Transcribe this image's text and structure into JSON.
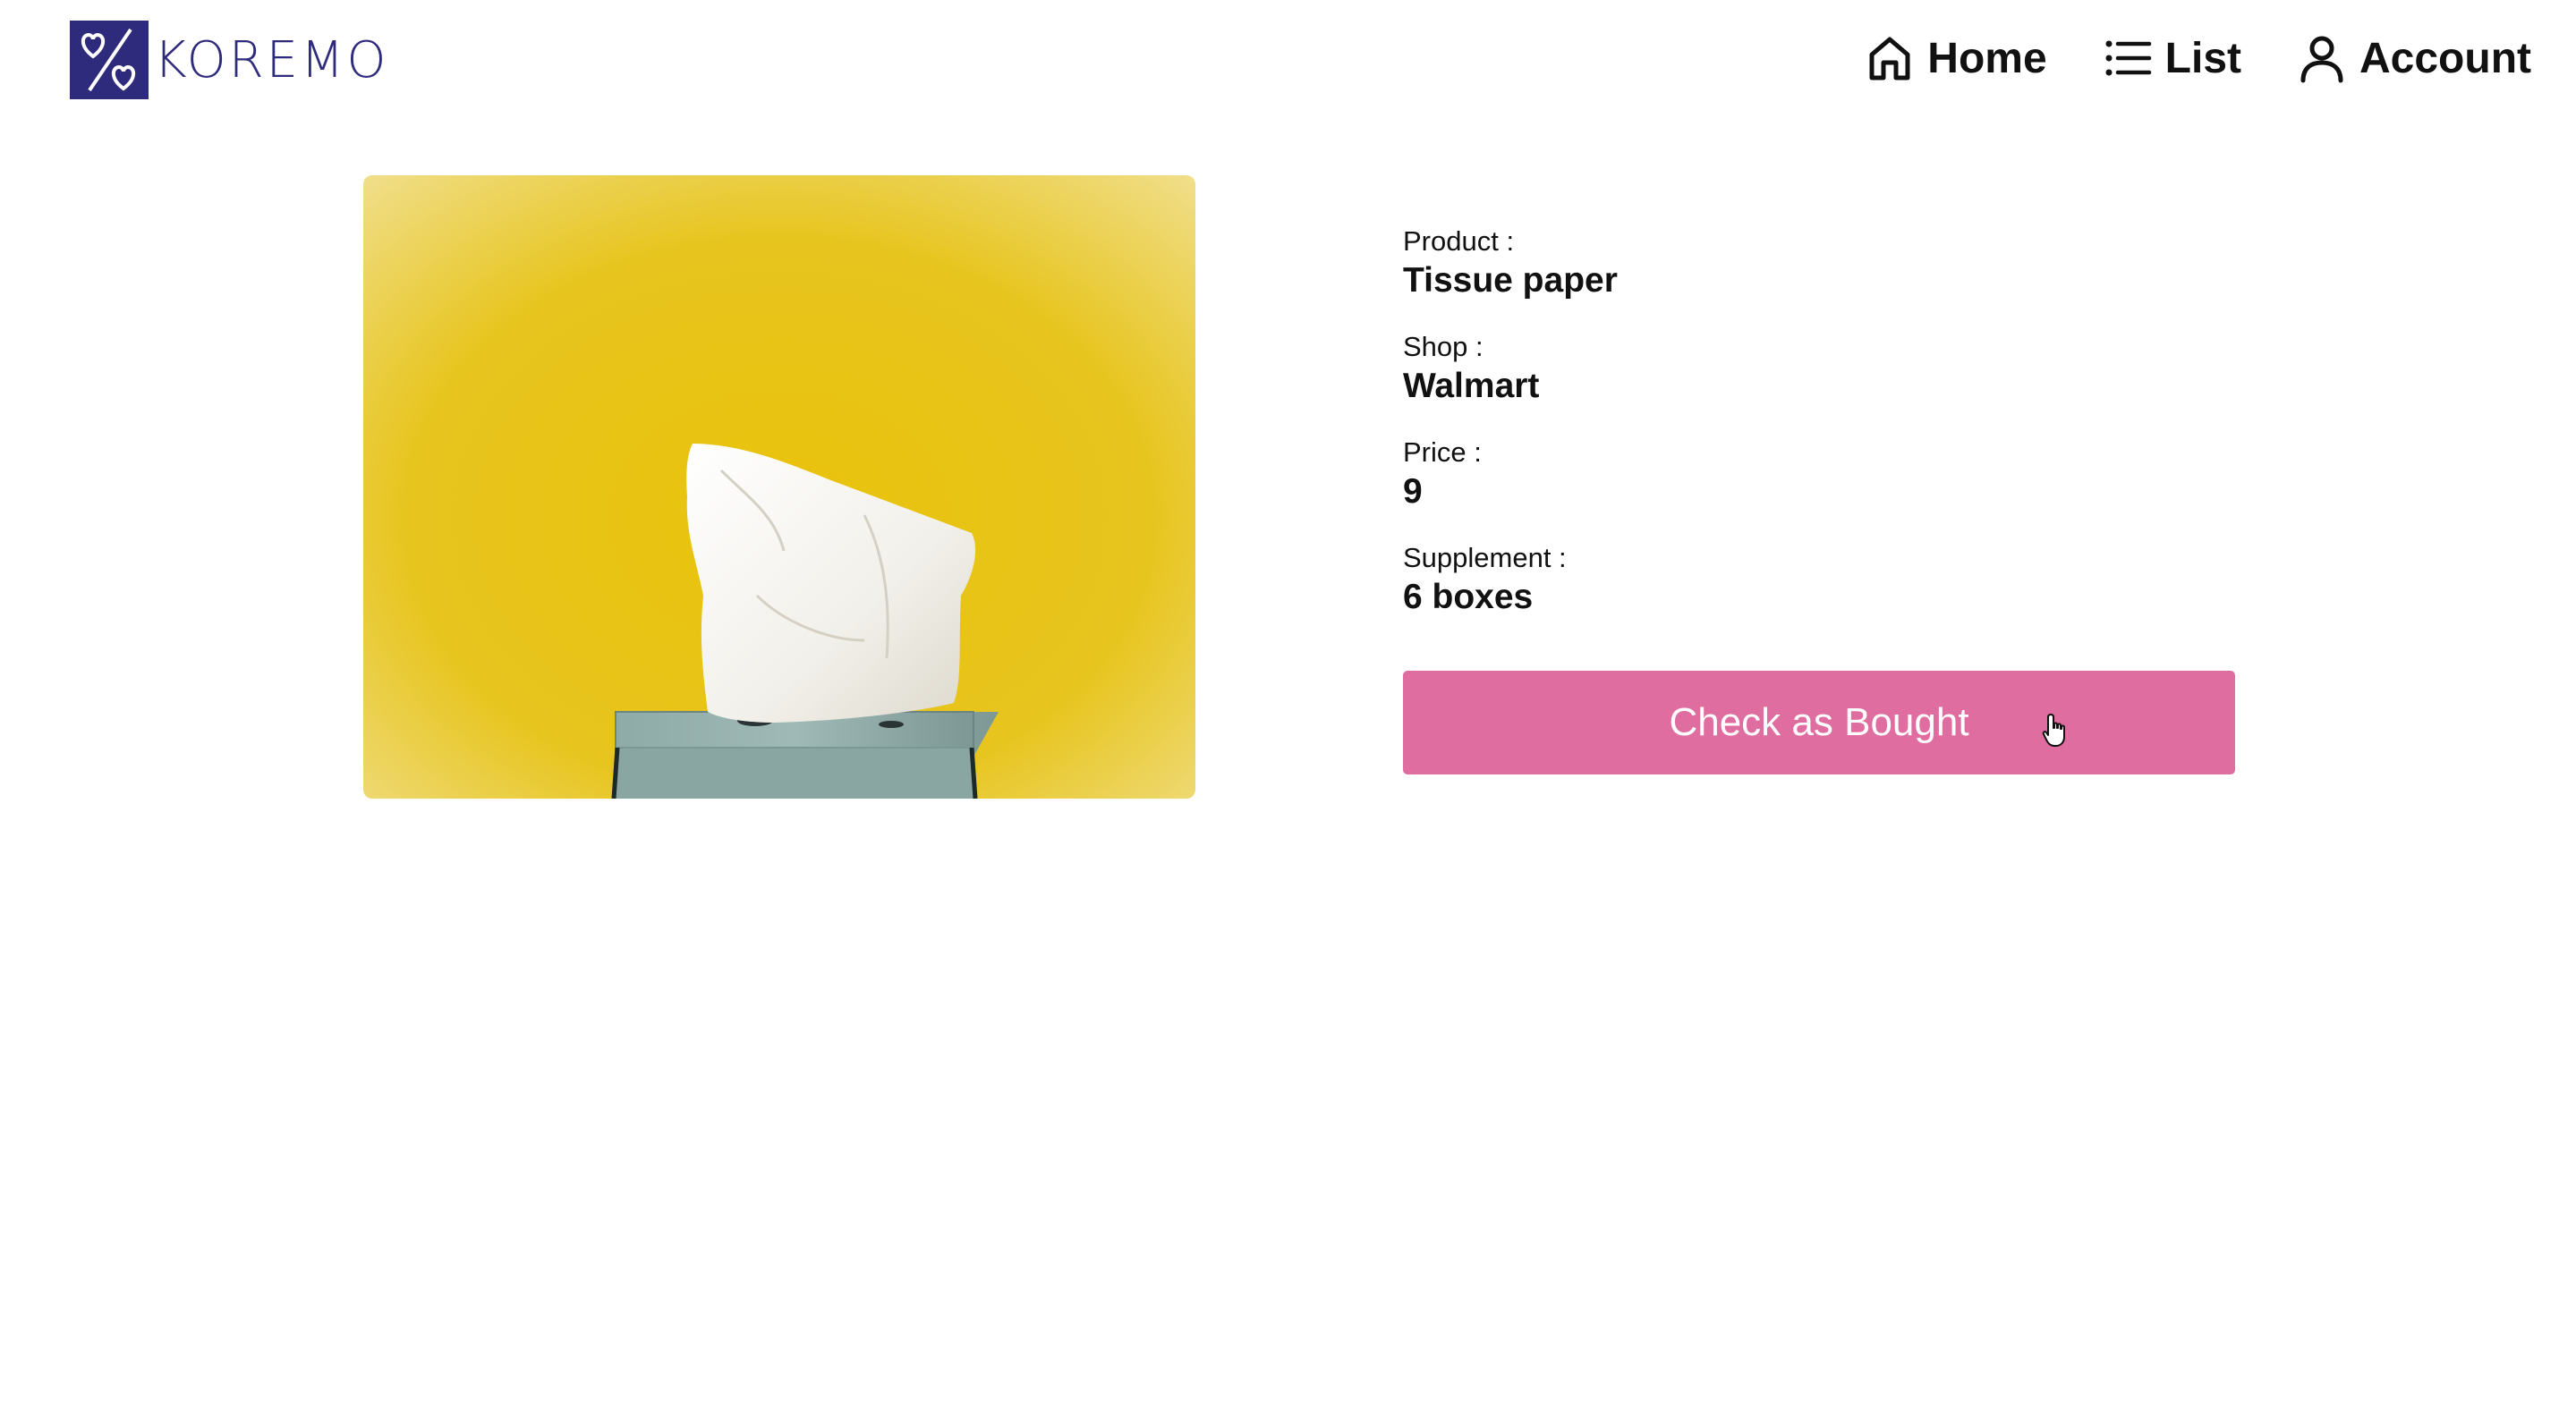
{
  "header": {
    "logo_text": "KOREMO",
    "logo_icon": "percent-hearts-logo",
    "nav": [
      {
        "label": "Home",
        "icon": "home-icon"
      },
      {
        "label": "List",
        "icon": "list-icon"
      },
      {
        "label": "Account",
        "icon": "user-icon"
      }
    ]
  },
  "product": {
    "image_alt": "Tissue box on yellow background",
    "fields": [
      {
        "label": "Product :",
        "value": "Tissue paper"
      },
      {
        "label": "Shop :",
        "value": "Walmart"
      },
      {
        "label": "Price :",
        "value": "9"
      },
      {
        "label": "Supplement :",
        "value": "6 boxes"
      }
    ],
    "action_label": "Check as Bought"
  },
  "colors": {
    "brand": "#2e2a7c",
    "button": "#e06d9f",
    "image_background": "#e8c10d"
  }
}
